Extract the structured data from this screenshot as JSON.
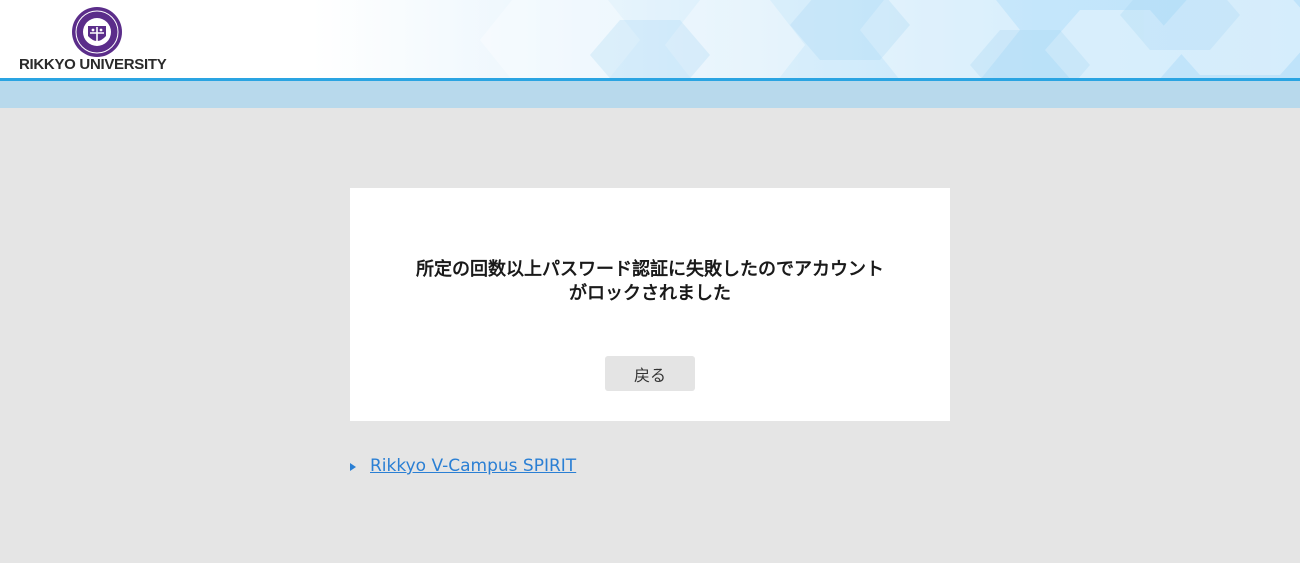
{
  "header": {
    "university_name": "RIKKYO UNIVERSITY",
    "seal_icon": "university-seal-icon",
    "colors": {
      "accent_line": "#2aa4e2",
      "sub_bar": "#b8d9ec",
      "seal": "#5b2d8a"
    }
  },
  "main": {
    "message": "所定の回数以上パスワード認証に失敗したのでアカウントがロックされました",
    "back_label": "戻る"
  },
  "links": {
    "bullet_icon": "triangle-bullet-icon",
    "spirit_label": "Rikkyo V-Campus SPIRIT",
    "link_color": "#2a7fd4"
  }
}
